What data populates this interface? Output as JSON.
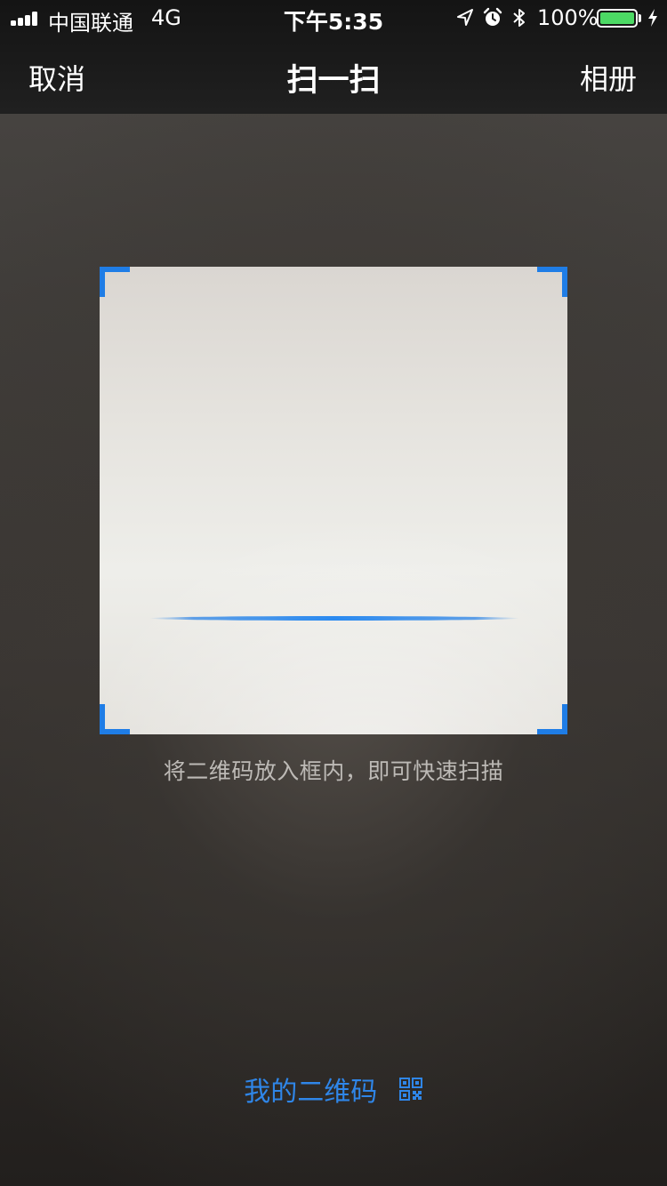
{
  "status_bar": {
    "carrier": "中国联通",
    "network": "4G",
    "time": "下午5:35",
    "battery_percent": "100%",
    "battery_level": 1.0,
    "icons": [
      "signal-icon",
      "location-arrow-icon",
      "alarm-icon",
      "bluetooth-icon",
      "battery-icon",
      "charging-icon"
    ]
  },
  "nav": {
    "cancel_label": "取消",
    "title": "扫一扫",
    "album_label": "相册"
  },
  "scanner": {
    "hint": "将二维码放入框内，即可快速扫描",
    "accent_color": "#1f7de6"
  },
  "footer": {
    "my_qr_label": "我的二维码",
    "icon": "qr-code-icon"
  }
}
